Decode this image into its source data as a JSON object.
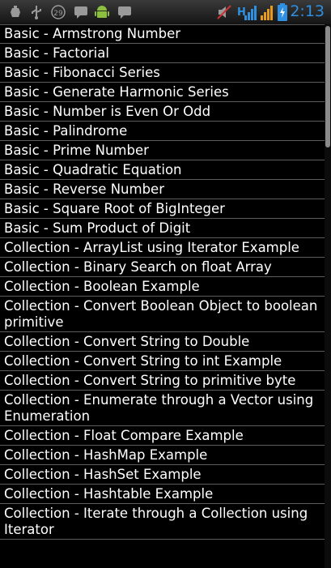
{
  "statusbar": {
    "time": "2:13",
    "icons": [
      "usb-debug-icon",
      "usb-icon",
      "badge-29-icon",
      "notification-icon",
      "android-icon",
      "notification-icon",
      "mute-icon",
      "signal-icon",
      "battery-icon"
    ],
    "badge_count": "29",
    "network_label": "H",
    "clock_color": "#2f8fe0"
  },
  "list": {
    "items": [
      "Basic - Armstrong Number",
      "Basic - Factorial",
      "Basic - Fibonacci Series",
      "Basic - Generate Harmonic Series",
      "Basic - Number is Even Or Odd",
      "Basic - Palindrome",
      "Basic - Prime Number",
      "Basic - Quadratic Equation",
      "Basic - Reverse Number",
      "Basic - Square Root of BigInteger",
      "Basic - Sum Product of Digit",
      "Collection - ArrayList using Iterator Example",
      "Collection - Binary Search on float Array",
      "Collection - Boolean Example",
      "Collection - Convert Boolean Object to boolean primitive",
      "Collection - Convert String to Double",
      "Collection - Convert String to int Example",
      "Collection - Convert String to primitive byte",
      "Collection - Enumerate through a Vector using Enumeration",
      "Collection - Float Compare Example",
      "Collection - HashMap Example",
      "Collection - HashSet Example",
      "Collection - Hashtable Example",
      "Collection - Iterate through a Collection using Iterator"
    ]
  }
}
